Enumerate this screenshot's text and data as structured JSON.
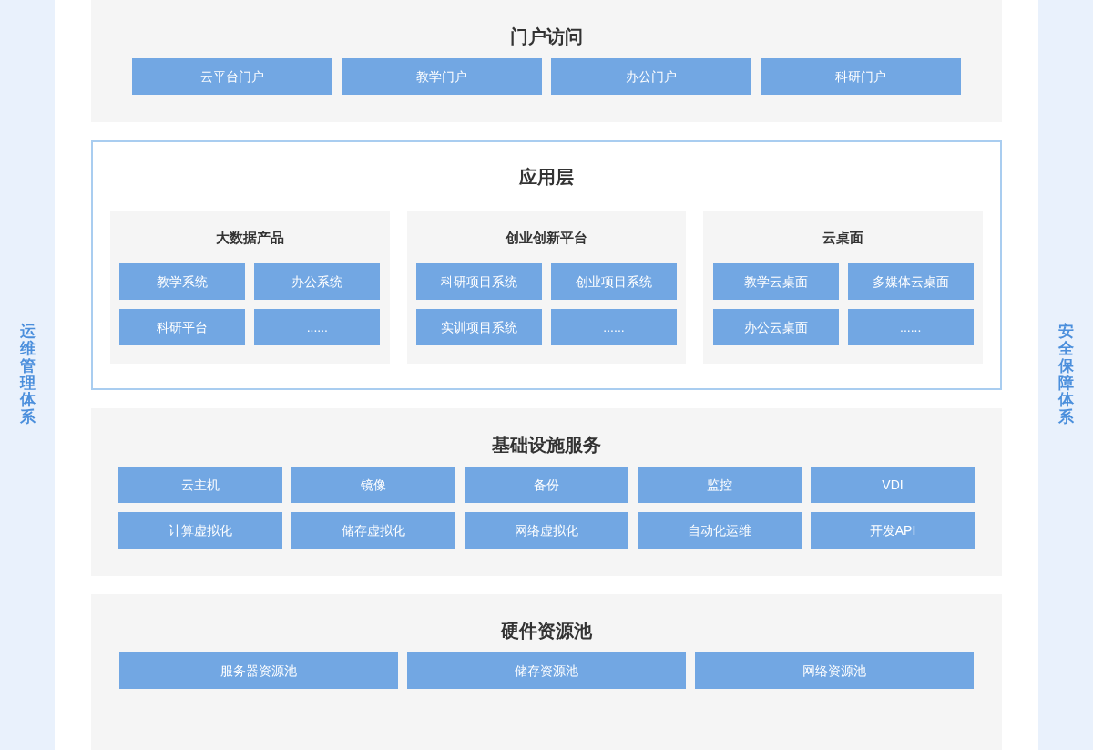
{
  "left_sidebar": {
    "label": "运维管理体系"
  },
  "right_sidebar": {
    "label": "安全保障体系"
  },
  "layers": [
    {
      "kind": "portal",
      "title": "门户访问",
      "items": [
        "云平台门户",
        "教学门户",
        "办公门户",
        "科研门户"
      ]
    },
    {
      "kind": "application",
      "title": "应用层",
      "groups": [
        {
          "title": "大数据产品",
          "items": [
            "教学系统",
            "办公系统",
            "科研平台",
            "......"
          ]
        },
        {
          "title": "创业创新平台",
          "items": [
            "科研项目系统",
            "创业项目系统",
            "实训项目系统",
            "......"
          ]
        },
        {
          "title": "云桌面",
          "items": [
            "教学云桌面",
            "多媒体云桌面",
            "办公云桌面",
            "......"
          ]
        }
      ]
    },
    {
      "kind": "infra",
      "title": "基础设施服务",
      "items": [
        "云主机",
        "镜像",
        "备份",
        "监控",
        "VDI",
        "计算虚拟化",
        "储存虚拟化",
        "网络虚拟化",
        "自动化运维",
        "开发API"
      ]
    },
    {
      "kind": "hardware",
      "title": "硬件资源池",
      "items": [
        "服务器资源池",
        "储存资源池",
        "网络资源池"
      ]
    }
  ]
}
